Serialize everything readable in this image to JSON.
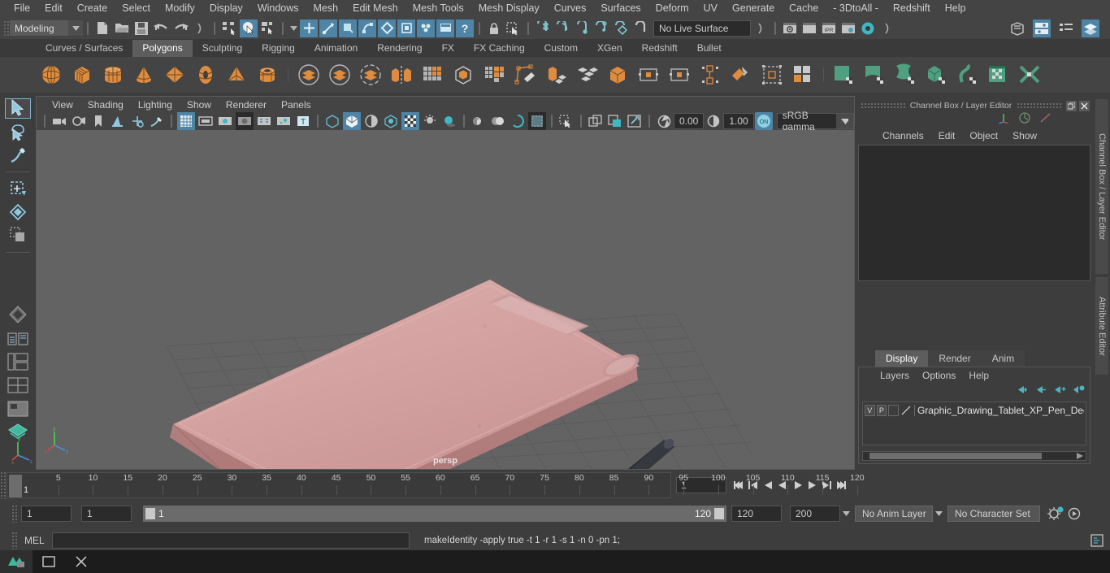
{
  "app": {
    "title": "Autodesk Maya"
  },
  "menubar": {
    "items": [
      "File",
      "Edit",
      "Create",
      "Select",
      "Modify",
      "Display",
      "Windows",
      "Mesh",
      "Edit Mesh",
      "Mesh Tools",
      "Mesh Display",
      "Curves",
      "Surfaces",
      "Deform",
      "UV",
      "Generate",
      "Cache",
      "- 3DtoAll -",
      "Redshift",
      "Help"
    ]
  },
  "statusline": {
    "mode": "Modeling",
    "live_surface": "No Live Surface",
    "numeric_a": "0.00",
    "numeric_b": "1.00"
  },
  "shelf": {
    "tabs": [
      "Curves / Surfaces",
      "Polygons",
      "Sculpting",
      "Rigging",
      "Animation",
      "Rendering",
      "FX",
      "FX Caching",
      "Custom",
      "XGen",
      "Redshift",
      "Bullet"
    ],
    "active_tab": "Polygons",
    "icons": [
      "poly-sphere",
      "poly-cube",
      "poly-cylinder",
      "poly-cone",
      "poly-plane",
      "poly-torus",
      "poly-pyramid",
      "poly-pipe",
      "boolean-union",
      "boolean-difference",
      "boolean-intersection",
      "mirror-geometry",
      "combine",
      "smooth",
      "extrude-face",
      "create-polygon-tool",
      "bevel",
      "multi-cut",
      "bridge",
      "append-polygon",
      "reduce",
      "quad-draw",
      "uv-editor",
      "uv-planar",
      "uv-cylindrical",
      "uv-automatic",
      "uv-unfold",
      "uv-layout",
      "uv-cut"
    ]
  },
  "toolbox": {
    "tools": [
      "select-tool",
      "lasso-select-tool",
      "paint-select-tool",
      "move-tool",
      "rotate-tool",
      "scale-tool",
      "last-tool-used",
      "show-manipulator-tool",
      "outliner-layout",
      "persp-outliner-layout",
      "persp-graph-layout",
      "four-view-layout",
      "single-perspective-layout",
      "hypershade-layout"
    ]
  },
  "viewport": {
    "menu": [
      "View",
      "Shading",
      "Lighting",
      "Show",
      "Renderer",
      "Panels"
    ],
    "camera_label": "persp",
    "gamma": "sRGB gamma",
    "exposure": "0.00",
    "contrast": "1.00",
    "axis_labels": {
      "x": "x",
      "y": "y",
      "z": "z"
    }
  },
  "channelbox": {
    "title": "Channel Box / Layer Editor",
    "menu": [
      "Channels",
      "Edit",
      "Object",
      "Show"
    ]
  },
  "layer_editor": {
    "tabs": [
      "Display",
      "Render",
      "Anim"
    ],
    "active_tab": "Display",
    "menu": [
      "Layers",
      "Options",
      "Help"
    ],
    "rows": [
      {
        "visible": "V",
        "playback": "P",
        "name": "Graphic_Drawing_Tablet_XP_Pen_Deco_P"
      }
    ]
  },
  "right_dock": {
    "tabs": [
      "Channel Box / Layer Editor",
      "Attribute Editor"
    ]
  },
  "timeslider": {
    "ticks": [
      5,
      10,
      15,
      20,
      25,
      30,
      35,
      40,
      45,
      50,
      55,
      60,
      65,
      70,
      75,
      80,
      85,
      90,
      95,
      100,
      105,
      110,
      115,
      120
    ],
    "current_frame": "1",
    "frame_field": "1"
  },
  "rangeslider": {
    "anim_start": "1",
    "range_start": "1",
    "range_start_inner": "1",
    "range_end_inner": "120",
    "range_end": "120",
    "anim_end": "200",
    "anim_layer": "No Anim Layer",
    "character_set": "No Character Set"
  },
  "commandline": {
    "language": "MEL",
    "input_value": "",
    "output": "makeIdentity -apply true -t 1 -r 1 -s 1 -n 0 -pn 1;"
  },
  "colors": {
    "bg_dark": "#3d3d3d",
    "panel": "#444444",
    "accent_blue": "#4e85a6",
    "shelf_orange": "#e08c3f",
    "shelf_green": "#4fa080",
    "viewport_bg": "#636363",
    "tablet_pink": "#d5a0a0"
  }
}
